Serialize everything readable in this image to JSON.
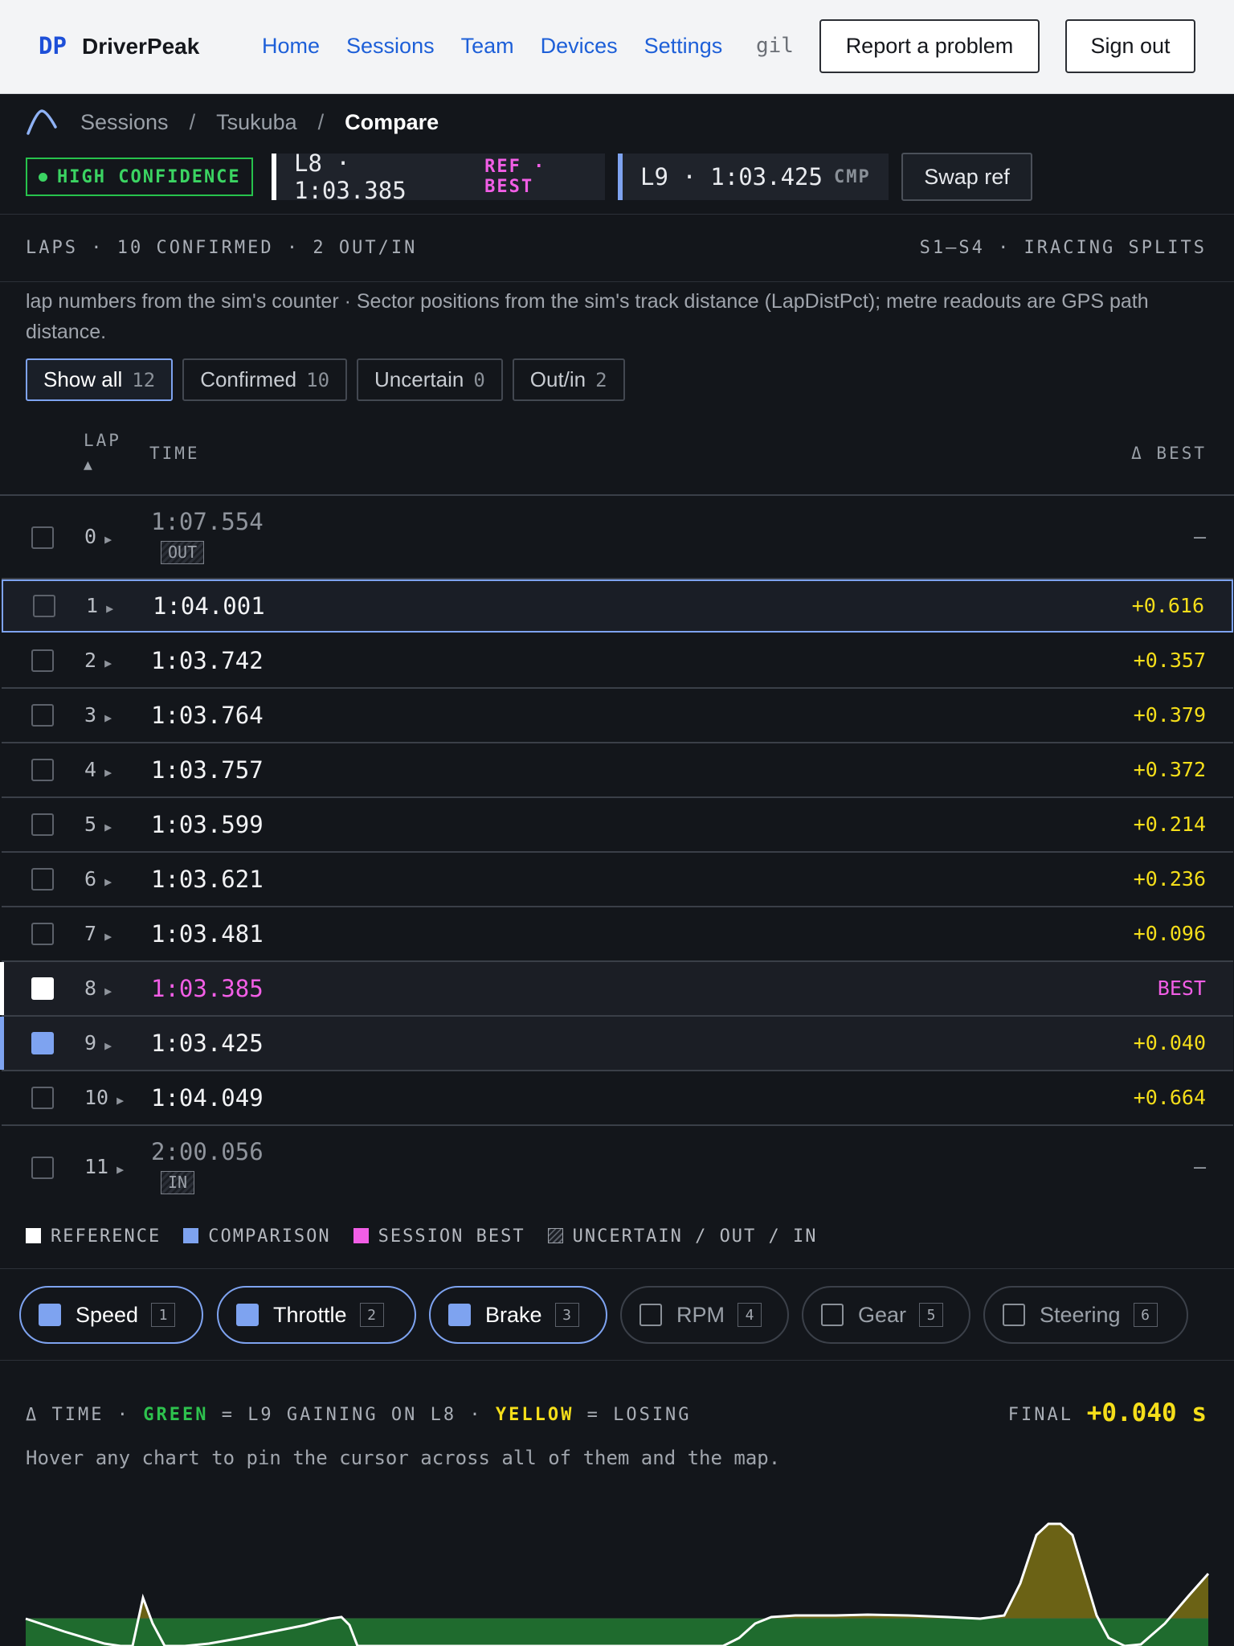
{
  "nav": {
    "logo": "DP",
    "brand": "DriverPeak",
    "links": [
      "Home",
      "Sessions",
      "Team",
      "Devices",
      "Settings"
    ],
    "user": "gil",
    "report_label": "Report a problem",
    "signout_label": "Sign out"
  },
  "breadcrumb": {
    "items": [
      "Sessions",
      "Tsukuba",
      "Compare"
    ]
  },
  "compare": {
    "confidence": "HIGH CONFIDENCE",
    "ref_lap": "L8 · 1:03.385",
    "ref_tag": "REF · BEST",
    "cmp_lap": "L9 · 1:03.425",
    "cmp_tag": "CMP",
    "swap_label": "Swap ref",
    "colors": {
      "ref": "#ffffff",
      "cmp": "#7ea3f0",
      "best": "#f25ee6",
      "confidence": "#27c24c"
    }
  },
  "laps_section": {
    "title": "LAPS · 10 CONFIRMED · 2 OUT/IN",
    "splits": "S1–S4 · IRACING SPLITS",
    "note": "lap numbers from the sim's counter · Sector positions from the sim's track distance (LapDistPct); metre readouts are GPS path distance.",
    "filters": [
      {
        "label": "Show all",
        "count": "12"
      },
      {
        "label": "Confirmed",
        "count": "10"
      },
      {
        "label": "Uncertain",
        "count": "0"
      },
      {
        "label": "Out/in",
        "count": "2"
      }
    ],
    "columns": {
      "lap": "LAP",
      "sort": "▲",
      "time": "TIME",
      "delta": "Δ BEST"
    },
    "rows": [
      {
        "lap": "0",
        "time": "1:07.554",
        "delta": "–",
        "badge": "OUT"
      },
      {
        "lap": "1",
        "time": "1:04.001",
        "delta": "+0.616"
      },
      {
        "lap": "2",
        "time": "1:03.742",
        "delta": "+0.357"
      },
      {
        "lap": "3",
        "time": "1:03.764",
        "delta": "+0.379"
      },
      {
        "lap": "4",
        "time": "1:03.757",
        "delta": "+0.372"
      },
      {
        "lap": "5",
        "time": "1:03.599",
        "delta": "+0.214"
      },
      {
        "lap": "6",
        "time": "1:03.621",
        "delta": "+0.236"
      },
      {
        "lap": "7",
        "time": "1:03.481",
        "delta": "+0.096"
      },
      {
        "lap": "8",
        "time": "1:03.385",
        "delta": "BEST"
      },
      {
        "lap": "9",
        "time": "1:03.425",
        "delta": "+0.040"
      },
      {
        "lap": "10",
        "time": "1:04.049",
        "delta": "+0.664"
      },
      {
        "lap": "11",
        "time": "2:00.056",
        "delta": "–",
        "badge": "IN"
      }
    ]
  },
  "legend": [
    "REFERENCE",
    "COMPARISON",
    "SESSION BEST",
    "UNCERTAIN / OUT / IN"
  ],
  "channels": [
    {
      "label": "Speed",
      "key": "1",
      "on": true
    },
    {
      "label": "Throttle",
      "key": "2",
      "on": true
    },
    {
      "label": "Brake",
      "key": "3",
      "on": true
    },
    {
      "label": "RPM",
      "key": "4",
      "on": false
    },
    {
      "label": "Gear",
      "key": "5",
      "on": false
    },
    {
      "label": "Steering",
      "key": "6",
      "on": false
    }
  ],
  "delta_chart": {
    "title_prefix": "Δ TIME · ",
    "green_word": "GREEN",
    "mid": " = L9 GAINING ON L8 · ",
    "yellow_word": "YELLOW",
    "suffix": " = LOSING",
    "final_label": "FINAL",
    "final_value": "+0.040 s",
    "hint": "Hover any chart to pin the cursor across all of them and the map.",
    "colors": {
      "gain": "#1f6b2e",
      "loss": "#6b6215",
      "line": "#ffffff"
    }
  }
}
